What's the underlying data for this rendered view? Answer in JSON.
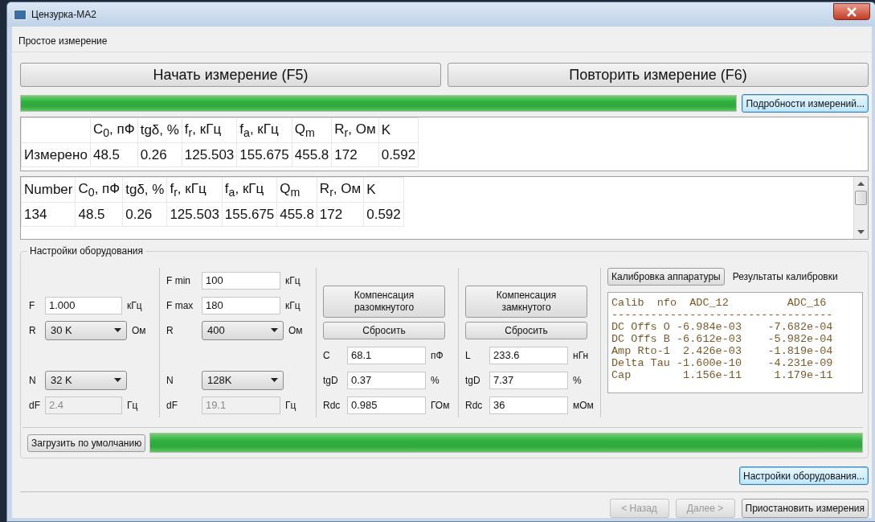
{
  "window": {
    "title": "Цензурка-MA2"
  },
  "mode_label": "Простое измерение",
  "main_buttons": [
    {
      "label": "Начать измерение (F5)"
    },
    {
      "label": "Повторить измерение (F6)"
    }
  ],
  "progress": {
    "level": 1
  },
  "details_button": {
    "label": "Подробности измерений...",
    "highlighted": true
  },
  "measured_table": {
    "columns": [
      "",
      "C$_{0}$, пФ",
      "tgδ, %",
      "f$_{r}$, кГц",
      "f$_{a}$, кГц",
      "Q$_{m}$",
      "R$_{r}$, Ом",
      "K"
    ],
    "rows": [
      [
        "Измерено",
        "48.5",
        "0.26",
        "125.503",
        "155.675",
        "455.8",
        "172",
        "0.592"
      ]
    ]
  },
  "history_table": {
    "columns": [
      "Number",
      "C$_{0}$, пФ",
      "tgδ, %",
      "f$_{r}$, кГц",
      "f$_{a}$, кГц",
      "Q$_{m}$",
      "R$_{r}$, Ом",
      "K"
    ],
    "rows": [
      [
        "134",
        "48.5",
        "0.26",
        "125.503",
        "155.675",
        "455.8",
        "172",
        "0.592"
      ]
    ]
  },
  "settings": {
    "title": "Настройки оборудования",
    "panels": [
      {
        "top": [
          {
            "kind": "field",
            "label": "F",
            "value": "1.000",
            "unit": "кГц",
            "disabled": false
          },
          {
            "kind": "combo",
            "label": "R",
            "value": "30  K",
            "unit": "Ом",
            "disabled": false
          }
        ],
        "bottom": [
          {
            "kind": "combo",
            "label": "N",
            "value": "32 K",
            "disabled": false
          },
          {
            "kind": "field",
            "label": "dF",
            "value": "2.4",
            "unit": "Гц",
            "disabled": true
          }
        ]
      },
      {
        "top": [
          {
            "kind": "field",
            "label": "F min",
            "value": "100",
            "unit": "кГц",
            "disabled": false
          },
          {
            "kind": "field",
            "label": "F max",
            "value": "180",
            "unit": "кГц",
            "disabled": false
          },
          {
            "kind": "combo",
            "label": "R",
            "value": "400",
            "unit": "Ом",
            "disabled": false
          }
        ],
        "bottom": [
          {
            "kind": "combo",
            "label": "N",
            "value": "128K",
            "disabled": false
          },
          {
            "kind": "field",
            "label": "dF",
            "value": "19.1",
            "unit": "Гц",
            "disabled": true
          }
        ]
      },
      {
        "top": [
          {
            "kind": "bigbutton",
            "value": "Компенсация разомкнутого",
            "disabled": false
          },
          {
            "kind": "button",
            "value": "Сбросить",
            "disabled": false
          }
        ],
        "bottom": [
          {
            "kind": "field",
            "label": "C",
            "value": "68.1",
            "unit": "пФ",
            "disabled": false
          },
          {
            "kind": "field",
            "label": "tgD",
            "value": "0.37",
            "unit": "%",
            "disabled": false
          },
          {
            "kind": "field",
            "label": "Rdc",
            "value": "0.985",
            "unit": "ГОм",
            "disabled": false
          }
        ]
      },
      {
        "top": [
          {
            "kind": "bigbutton",
            "value": "Компенсация замкнутого",
            "disabled": false
          },
          {
            "kind": "button",
            "value": "Сбросить",
            "disabled": false
          }
        ],
        "bottom": [
          {
            "kind": "field",
            "label": "L",
            "value": "233.6",
            "unit": "нГн",
            "disabled": false
          },
          {
            "kind": "field",
            "label": "tgD",
            "value": "7.37",
            "unit": "%",
            "disabled": false
          },
          {
            "kind": "field",
            "label": "Rdc",
            "value": "36",
            "unit": "мОм",
            "disabled": false
          }
        ]
      }
    ],
    "calibration": {
      "button": "Калибровка аппаратуры",
      "label": "Результаты калибровки",
      "lines": [
        "Calib  nfo  ADC_12         ADC_16",
        "----------------------------------",
        "DC Offs O -6.984e-03    -7.682e-04",
        "DC Offs B -6.612e-03    -5.982e-04",
        "Amp Rto-1  2.426e-03    -1.819e-04",
        "Delta Tau -1.600e-10    -4.231e-09",
        "Cap        1.156e-11     1.179e-11"
      ]
    },
    "defaults_button": "Загрузить по умолчанию",
    "defaults_progress": {
      "level": 1
    }
  },
  "settings_button": {
    "label": "Настройки оборудования...",
    "highlighted": true
  },
  "nav_buttons": [
    {
      "label": "< Назад",
      "disabled": true
    },
    {
      "label": "Далее >",
      "disabled": true
    },
    {
      "label": "Приостановить измерения",
      "disabled": false
    }
  ]
}
